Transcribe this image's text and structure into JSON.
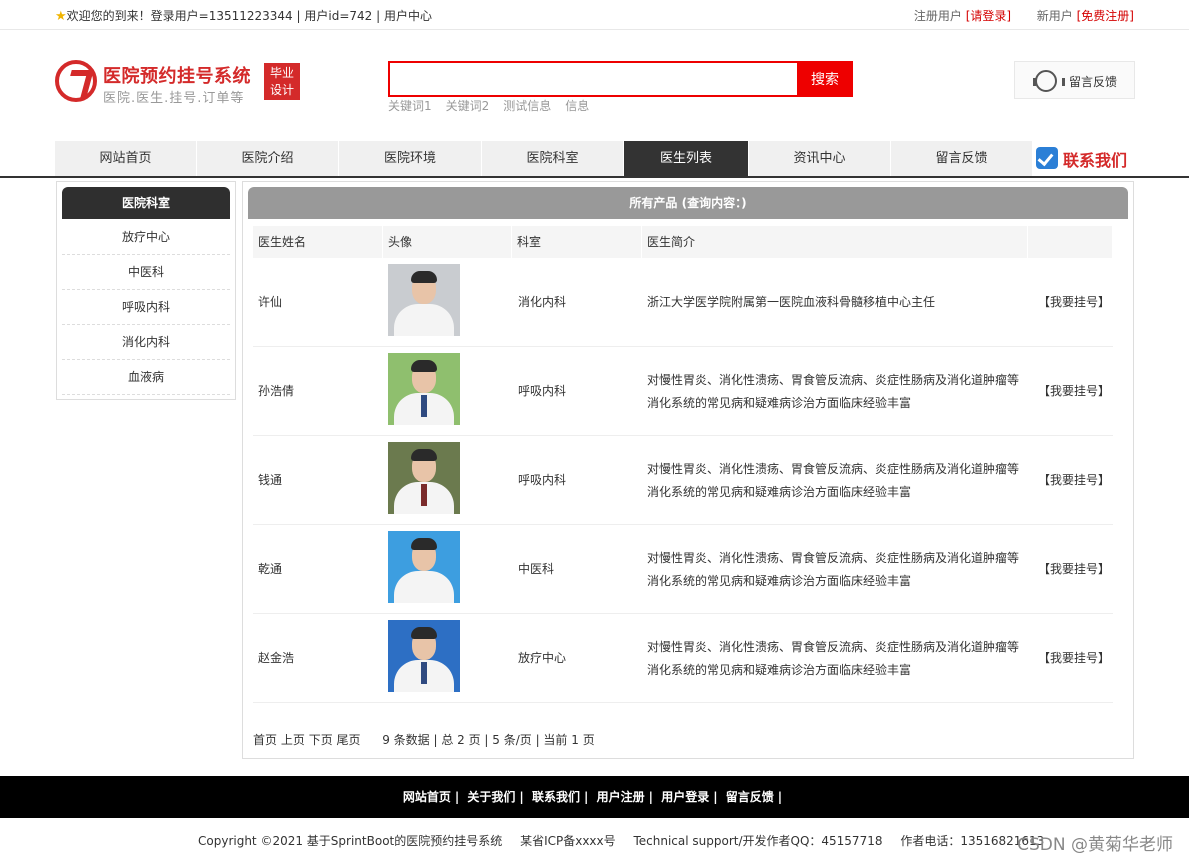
{
  "topbar": {
    "welcome": "欢迎您的到来！登录用户=13511223344 | 用户id=742 | 用户中心",
    "register_prefix": "注册用户",
    "login_link": "[请登录]",
    "new_user_prefix": "新用户",
    "signup_link": "[免费注册]"
  },
  "logo": {
    "title": "医院预约挂号系统",
    "subtitle": "医院.医生.挂号.订单等",
    "badge_line1": "毕业",
    "badge_line2": "设计"
  },
  "search": {
    "placeholder": "",
    "button": "搜索",
    "keywords": [
      "关键词1",
      "关键词2",
      "测试信息",
      "信息"
    ]
  },
  "feedback_box": {
    "label": "留言反馈",
    "icon": "headset-icon"
  },
  "nav": {
    "items": [
      "网站首页",
      "医院介绍",
      "医院环境",
      "医院科室",
      "医生列表",
      "资讯中心",
      "留言反馈"
    ],
    "active": "医生列表",
    "contact": "联系我们"
  },
  "sidebar": {
    "title": "医院科室",
    "items": [
      "放疗中心",
      "中医科",
      "呼吸内科",
      "消化内科",
      "血液病"
    ]
  },
  "main": {
    "title": "所有产品 (查询内容：)",
    "columns": [
      "医生姓名",
      "头像",
      "科室",
      "医生简介",
      ""
    ],
    "action_label": "【我要挂号】",
    "rows": [
      {
        "name": "许仙",
        "dept": "消化内科",
        "intro": "浙江大学医学院附属第一医院血液科骨髓移植中心主任"
      },
      {
        "name": "孙浩倩",
        "dept": "呼吸内科",
        "intro": "对慢性胃炎、消化性溃疡、胃食管反流病、炎症性肠病及消化道肿瘤等消化系统的常见病和疑难病诊治方面临床经验丰富"
      },
      {
        "name": "钱通",
        "dept": "呼吸内科",
        "intro": "对慢性胃炎、消化性溃疡、胃食管反流病、炎症性肠病及消化道肿瘤等消化系统的常见病和疑难病诊治方面临床经验丰富"
      },
      {
        "name": "乾通",
        "dept": "中医科",
        "intro": "对慢性胃炎、消化性溃疡、胃食管反流病、炎症性肠病及消化道肿瘤等消化系统的常见病和疑难病诊治方面临床经验丰富"
      },
      {
        "name": "赵金浩",
        "dept": "放疗中心",
        "intro": "对慢性胃炎、消化性溃疡、胃食管反流病、炎症性肠病及消化道肿瘤等消化系统的常见病和疑难病诊治方面临床经验丰富"
      }
    ],
    "pager": {
      "first": "首页",
      "prev": "上页",
      "next": "下页",
      "last": "尾页",
      "summary": "9 条数据 | 总 2 页 | 5 条/页 | 当前 1 页"
    }
  },
  "footer": {
    "links": [
      "网站首页",
      "关于我们",
      "联系我们",
      "用户注册",
      "用户登录",
      "留言反馈"
    ],
    "copyright": "Copyright ©2021 基于SprintBoot的医院预约挂号系统",
    "icp": "某省ICP备xxxx号",
    "support": "Technical support/开发作者QQ：45157718",
    "phone": "作者电话：13516821613",
    "watermark": "CSDN @黄菊华老师"
  },
  "colors": {
    "accent": "#e00000",
    "brand": "#d42a2a",
    "nav_active": "#333333"
  }
}
